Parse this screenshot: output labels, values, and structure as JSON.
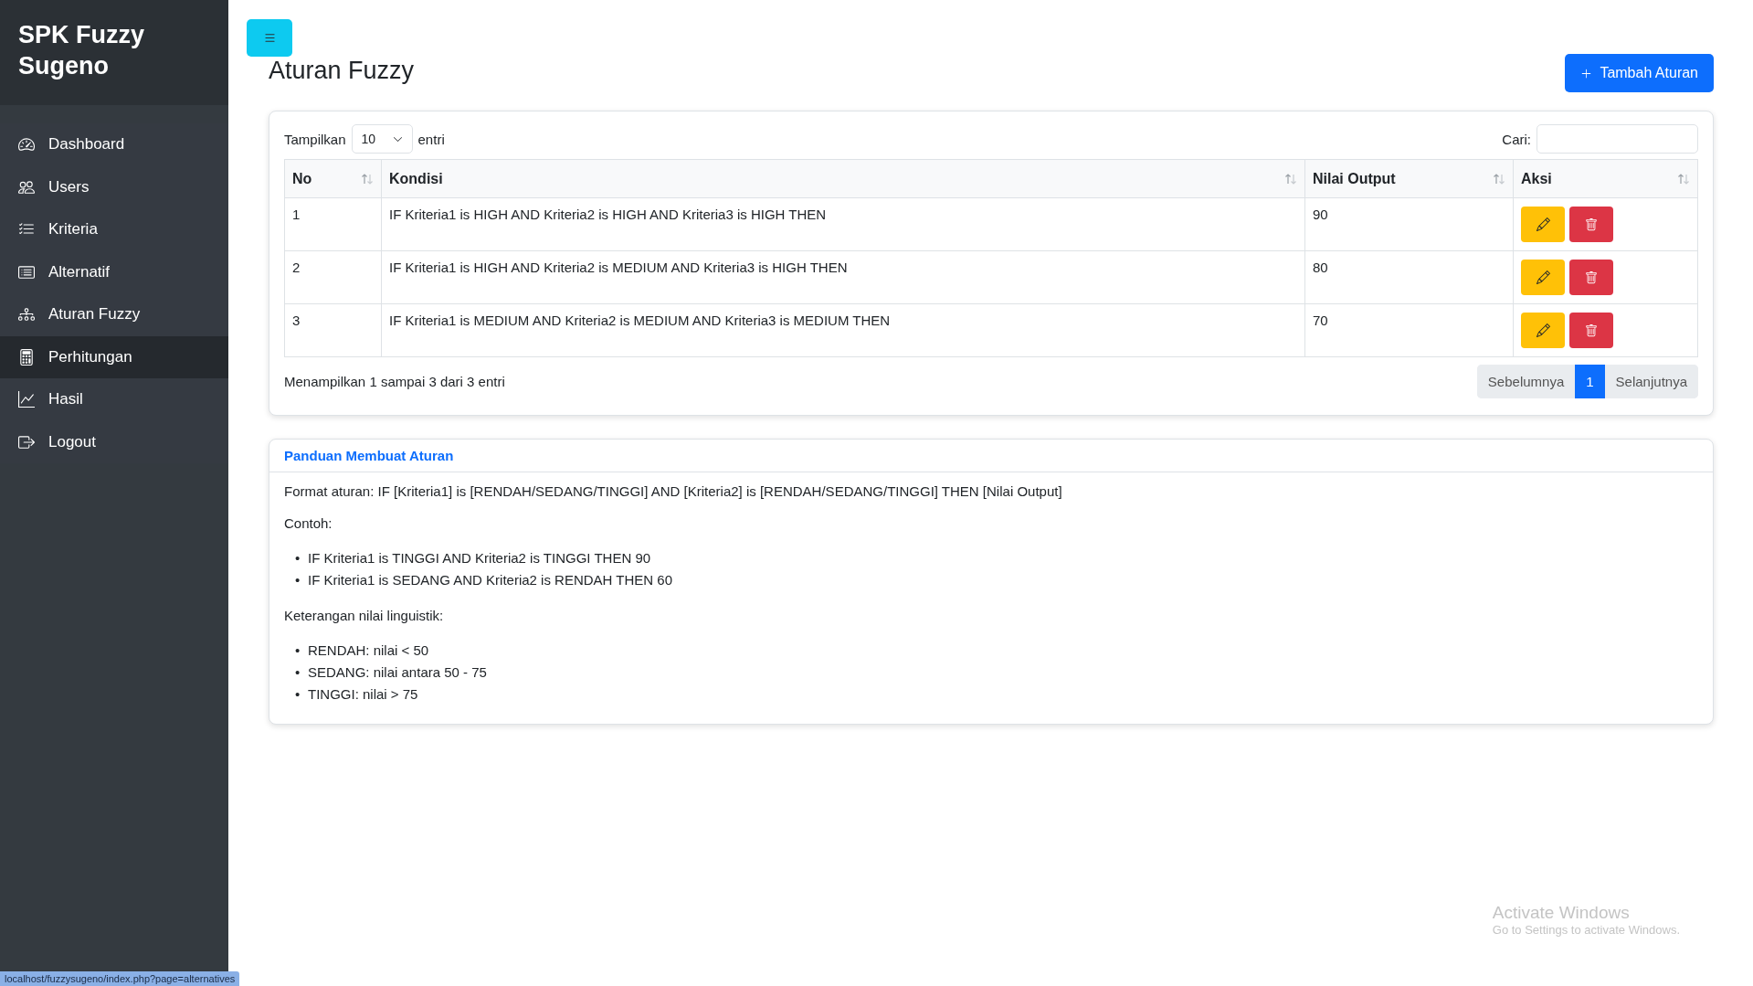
{
  "sidebar": {
    "brand": "SPK Fuzzy Sugeno",
    "items": [
      {
        "label": "Dashboard",
        "selected": false
      },
      {
        "label": "Users",
        "selected": false
      },
      {
        "label": "Kriteria",
        "selected": false
      },
      {
        "label": "Alternatif",
        "selected": false
      },
      {
        "label": "Aturan Fuzzy",
        "selected": false
      },
      {
        "label": "Perhitungan",
        "selected": true
      },
      {
        "label": "Hasil",
        "selected": false
      },
      {
        "label": "Logout",
        "selected": false
      }
    ]
  },
  "page": {
    "title": "Aturan Fuzzy",
    "add_button": "Tambah Aturan"
  },
  "rules_table": {
    "length_label": "Tampilkan",
    "length_value": "10",
    "length_suffix": "entri",
    "search_label": "Cari:",
    "columns": [
      "No",
      "Kondisi",
      "Nilai Output",
      "Aksi"
    ],
    "rows": [
      {
        "no": "1",
        "kondisi": "IF Kriteria1 is HIGH AND Kriteria2 is HIGH AND Kriteria3 is HIGH THEN",
        "nilai_output": "90"
      },
      {
        "no": "2",
        "kondisi": "IF Kriteria1 is HIGH AND Kriteria2 is MEDIUM AND Kriteria3 is HIGH THEN",
        "nilai_output": "80"
      },
      {
        "no": "3",
        "kondisi": "IF Kriteria1 is MEDIUM AND Kriteria2 is MEDIUM AND Kriteria3 is MEDIUM THEN",
        "nilai_output": "70"
      }
    ],
    "info": "Menampilkan 1 sampai 3 dari 3 entri",
    "pagination": {
      "previous": "Sebelumnya",
      "pages": [
        {
          "label": "1",
          "selected": true
        }
      ],
      "next": "Selanjutnya"
    }
  },
  "guide": {
    "title": "Panduan Membuat Aturan",
    "bullet": "•",
    "format": "Format aturan: IF [Kriteria1] is [RENDAH/SEDANG/TINGGI] AND [Kriteria2] is [RENDAH/SEDANG/TINGGI] THEN [Nilai Output]",
    "examples_heading": "Contoh:",
    "examples": [
      "IF Kriteria1 is TINGGI AND Kriteria2 is TINGGI THEN 90",
      "IF Kriteria1 is SEDANG AND Kriteria2 is RENDAH THEN 60"
    ],
    "legend_heading": "Keterangan nilai linguistik:",
    "legend": [
      "RENDAH: nilai < 50",
      "SEDANG: nilai antara 50 - 75",
      "TINGGI: nilai > 75"
    ]
  },
  "status_bar": {
    "url": "localhost/fuzzysugeno/index.php?page=alternatives"
  },
  "os_notice": {
    "title": "Activate Windows",
    "subtitle": "Go to Settings to activate Windows."
  }
}
